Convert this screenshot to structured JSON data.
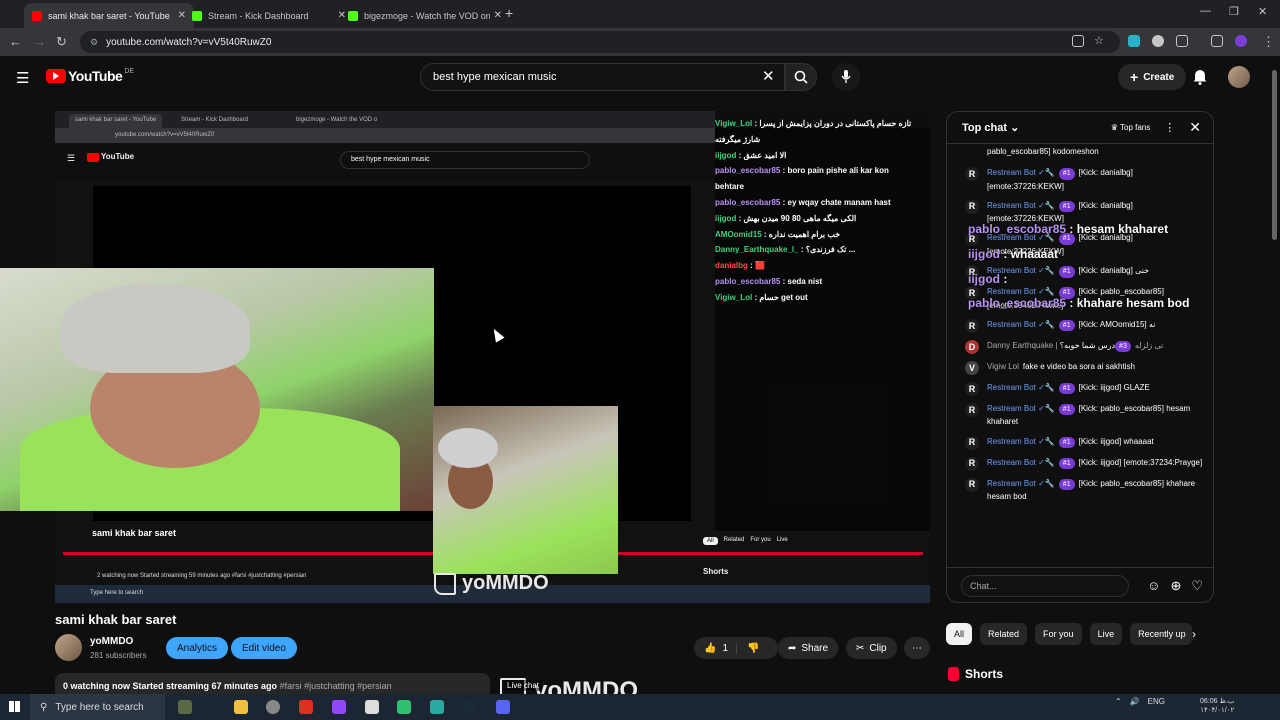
{
  "browser": {
    "tabs": [
      {
        "title": "sami khak bar saret - YouTube",
        "icon": "youtube-icon",
        "active": true
      },
      {
        "title": "Stream - Kick Dashboard",
        "icon": "kick-icon",
        "active": false
      },
      {
        "title": "bigezmoge - Watch the VOD on",
        "icon": "kick-icon",
        "active": false
      }
    ],
    "url": "youtube.com/watch?v=vV5t40RuwZ0"
  },
  "header": {
    "logo_text": "YouTube",
    "country": "DE",
    "search_value": "best hype mexican music",
    "create_label": "Create"
  },
  "player": {
    "inner": {
      "tabs": [
        "sami khak bar saret - YouTube",
        "Stream - Kick Dashboard",
        "bigezmoge - Watch the VOD o"
      ],
      "url": "youtube.com/watch?v=vV5t40RuwZ0",
      "search": "best hype mexican music",
      "title": "sami khak bar saret",
      "meta": "2 watching now  Started streaming 59 minutes ago  #farsi #justchatting #persian",
      "taskbar_search": "Type here to search"
    },
    "overlay_chat": [
      {
        "user": "Vigiw_Lol",
        "cls": "ov-user",
        "text": ": تازه حسام پاکستانی در دوران پزایمش از پسرا"
      },
      {
        "user": "",
        "cls": "ov-user",
        "text": "شارژ میگرفته"
      },
      {
        "user": "iijgod",
        "cls": "ov-user",
        "text": ": الا امید عشق"
      },
      {
        "user": "pablo_escobar85",
        "cls": "ov-pablo",
        "text": ": boro pain pishe ali kar kon"
      },
      {
        "user": "",
        "cls": "ov-pablo",
        "text": "behtare"
      },
      {
        "user": "pablo_escobar85",
        "cls": "ov-pablo",
        "text": ": ey wqay chate manam hast"
      },
      {
        "user": "iijgod",
        "cls": "ov-user",
        "text": ": الکی میگه ماهی 80 90 میدن بهش"
      },
      {
        "user": "AMOomid15",
        "cls": "ov-user",
        "text": ": خب برام اهمیت نداره"
      },
      {
        "user": "Danny_Earthquake_l_",
        "cls": "ov-user",
        "text": ": تک فرزندی؟ ..."
      },
      {
        "user": "danialbg",
        "cls": "ov-red",
        "text": ": 🟥"
      },
      {
        "user": "pablo_escobar85",
        "cls": "ov-pablo",
        "text": ": seda nist"
      },
      {
        "user": "Vigiw_Lol",
        "cls": "ov-user",
        "text": ": حسام get out"
      }
    ],
    "watermark": "yoMMDO",
    "shorts_label": "Shorts"
  },
  "video": {
    "title": "sami khak bar saret",
    "channel": "yoMMDO",
    "subscribers": "281 subscribers",
    "analytics_label": "Analytics",
    "edit_label": "Edit video",
    "likes": "1",
    "share_label": "Share",
    "clip_label": "Clip",
    "description_stats": "0 watching now  Started streaming 67 minutes ago",
    "description_tags": "#farsi #justchatting #persian",
    "bottom_watermark": "yoMMDO",
    "live_chat_tag": "Live chat"
  },
  "chat": {
    "title": "Top chat",
    "top_fans": "Top fans",
    "placeholder": "Chat...",
    "messages": [
      {
        "avatar": "",
        "name": "",
        "badge": "",
        "text": "pablo_escobar85] kodomeshon"
      },
      {
        "avatar": "R",
        "name": "Restream Bot ✓🔧",
        "badge": "#1",
        "text": "[Kick: danialbg] [emote:37226:KEKW]"
      },
      {
        "avatar": "R",
        "name": "Restream Bot ✓🔧",
        "badge": "#1",
        "text": "[Kick: danialbg] [emote:37226:KEKW]"
      },
      {
        "avatar": "R",
        "name": "Restream Bot ✓🔧",
        "badge": "#1",
        "text": "[Kick: danialbg] [emote:37226:KEKW]"
      },
      {
        "avatar": "R",
        "name": "Restream Bot ✓🔧",
        "badge": "#1",
        "text": "[Kick: danialbg] خنی"
      },
      {
        "avatar": "R",
        "name": "Restream Bot ✓🔧",
        "badge": "#1",
        "text": "[Kick: pablo_escobar85] [emote:39402:Flowie]"
      },
      {
        "avatar": "R",
        "name": "Restream Bot ✓🔧",
        "badge": "#1",
        "text": "[Kick: AMOomid15] نه"
      },
      {
        "avatar": "D",
        "name": "Danny Earthquake | تی زلزله",
        "badge": "#3",
        "text": "درس شما خوبه؟"
      },
      {
        "avatar": "V",
        "name": "Vigiw Lol",
        "badge": "",
        "text": "fake e video ba sora ai sakhtish"
      },
      {
        "avatar": "R",
        "name": "Restream Bot ✓🔧",
        "badge": "#1",
        "text": "[Kick: iijgod] GLAZE"
      },
      {
        "avatar": "R",
        "name": "Restream Bot ✓🔧",
        "badge": "#1",
        "text": "[Kick: pablo_escobar85] hesam khaharet"
      },
      {
        "avatar": "R",
        "name": "Restream Bot ✓🔧",
        "badge": "#1",
        "text": "[Kick: iijgod] whaaaat"
      },
      {
        "avatar": "R",
        "name": "Restream Bot ✓🔧",
        "badge": "#1",
        "text": "[Kick: iijgod] [emote:37234:Prayge]"
      },
      {
        "avatar": "R",
        "name": "Restream Bot ✓🔧",
        "badge": "#1",
        "text": "[Kick: pablo_escobar85] khahare hesam bod"
      }
    ],
    "overlays": [
      {
        "user": "pablo_escobar85",
        "text": " : hesam khaharet"
      },
      {
        "user": "iijgod",
        "text": " : whaaaat"
      },
      {
        "user": "iijgod",
        "text": " :"
      },
      {
        "user": "pablo_escobar85",
        "text": " : khahare hesam bod"
      }
    ]
  },
  "chips": [
    "All",
    "Related",
    "For you",
    "Live",
    "Recently up"
  ],
  "shorts_title": "Shorts",
  "taskbar": {
    "search_placeholder": "Type here to search",
    "lang": "ENG",
    "time": "06:06 ب.ظ",
    "date": "۱۴۰۴/۰۱/۰۲"
  },
  "colors": {
    "yt_red": "#ff0000",
    "accent_blue": "#3ea6ff",
    "badge_purple": "#7a3ad6",
    "chat_green": "#3fd47f"
  }
}
